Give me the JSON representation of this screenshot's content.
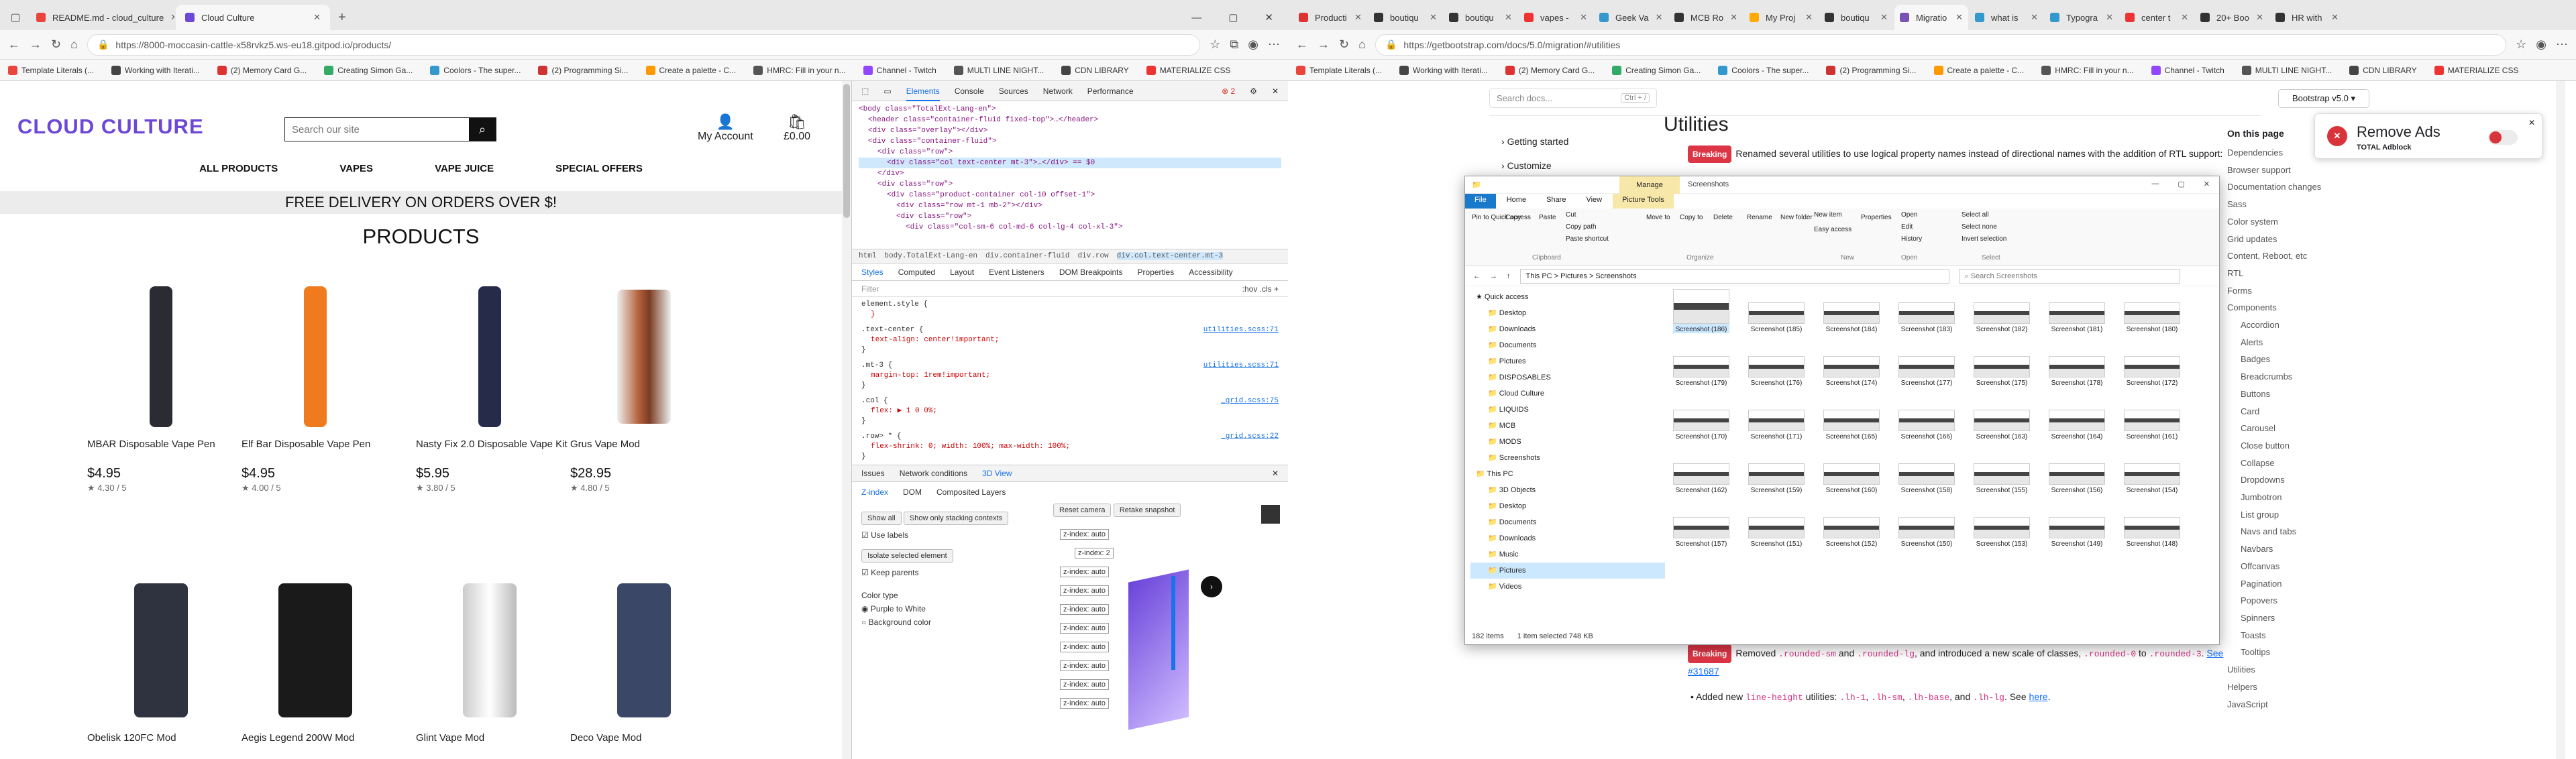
{
  "left_browser": {
    "tabs": [
      {
        "title": "README.md - cloud_culture",
        "color": "#e8453c"
      },
      {
        "title": "Cloud Culture",
        "color": "#6d48d6",
        "active": true
      }
    ],
    "url": "https://8000-moccasin-cattle-x58rvkz5.ws-eu18.gitpod.io/products/",
    "bookmarks": [
      "Template Literals (...",
      "Working with Iterati...",
      "(2) Memory Card G...",
      "Creating Simon Ga...",
      "Coolors - The super...",
      "(2) Programming Si...",
      "Create a palette - C...",
      "HMRC: Fill in your n...",
      "Channel - Twitch",
      "MULTI LINE NIGHT...",
      "CDN LIBRARY",
      "MATERIALIZE CSS"
    ]
  },
  "site": {
    "logo": "CLOUD CULTURE",
    "search_placeholder": "Search our site",
    "account_label": "My Account",
    "cart_total": "£0.00",
    "menu": [
      "ALL PRODUCTS",
      "VAPES",
      "VAPE JUICE",
      "SPECIAL OFFERS"
    ],
    "banner": "FREE DELIVERY ON ORDERS OVER $!",
    "heading": "PRODUCTS",
    "products": [
      {
        "name": "MBAR Disposable Vape Pen",
        "price": "$4.95",
        "rating": "4.30 / 5",
        "color": "#2b2b33"
      },
      {
        "name": "Elf Bar Disposable Vape Pen",
        "price": "$4.95",
        "rating": "4.00 / 5",
        "color": "#f07a1e"
      },
      {
        "name": "Nasty Fix 2.0 Disposable Vape Kit",
        "price": "$5.95",
        "rating": "3.80 / 5",
        "color": "#262b4a"
      },
      {
        "name": "Grus Vape Mod",
        "price": "$28.95",
        "rating": "4.80 / 5",
        "color": "#b4613b"
      },
      {
        "name": "Obelisk 120FC Mod",
        "color": "#2f3340"
      },
      {
        "name": "Aegis Legend 200W Mod",
        "color": "#1a1a1a"
      },
      {
        "name": "Glint Vape Mod",
        "color": "#d9d9d9"
      },
      {
        "name": "Deco Vape Mod",
        "color": "#3a4766"
      }
    ]
  },
  "devtools": {
    "tabs": [
      "Elements",
      "Console",
      "Sources",
      "Network",
      "Performance"
    ],
    "issues": "2",
    "dom_lines": [
      "<body class=\"TotalExt-Lang-en\">",
      "<header class=\"container-fluid fixed-top\">…</header>",
      "<div class=\"overlay\"></div>",
      "<div class=\"container-fluid\">",
      "<div class=\"row\">",
      "<div class=\"col text-center mt-3\">…</div> == $0",
      "</div>",
      "<div class=\"row\">",
      "<div class=\"product-container col-10 offset-1\">",
      "<div class=\"row mt-1 mb-2\"></div>",
      "<div class=\"row\">",
      "<div class=\"col-sm-6 col-md-6 col-lg-4 col-xl-3\">"
    ],
    "breadcrumbs": [
      "html",
      "body.TotalExt-Lang-en",
      "div.container-fluid",
      "div.row",
      "div.col.text-center.mt-3"
    ],
    "style_tabs": [
      "Styles",
      "Computed",
      "Layout",
      "Event Listeners",
      "DOM Breakpoints",
      "Properties",
      "Accessibility"
    ],
    "filter": "Filter",
    "css_rules": [
      {
        "selector": "element.style {",
        "body": "}",
        "src": ""
      },
      {
        "selector": ".text-center {",
        "body": "text-align: center!important;",
        "src": "utilities.scss:71"
      },
      {
        "selector": ".mt-3 {",
        "body": "margin-top: 1rem!important;",
        "src": "utilities.scss:71"
      },
      {
        "selector": ".col {",
        "body": "flex: ▶ 1 0 0%;",
        "src": "_grid.scss:75"
      },
      {
        "selector": ".row> * {",
        "body": "flex-shrink: 0; width: 100%; max-width: 100%;",
        "src": "_grid.scss:22"
      }
    ],
    "bottom_tabs": [
      "Issues",
      "Network conditions",
      "3D View"
    ],
    "three_tabs": [
      "Z-index",
      "DOM",
      "Composited Layers"
    ],
    "reset_camera": "Reset camera",
    "retake": "Retake snapshot",
    "show_all": "Show all",
    "show_stacking": "Show only stacking contexts",
    "use_labels": "Use labels",
    "isolate": "Isolate selected element",
    "keep_parents": "Keep parents",
    "color_type": "Color type",
    "purple_white": "Purple to White",
    "bg_color": "Background color",
    "zlabels": [
      "z-index: auto",
      "z-index: 2",
      "z-index: auto",
      "z-index: auto",
      "z-index: auto",
      "z-index: auto",
      "z-index: auto",
      "z-index: auto",
      "z-index: auto",
      "z-index: auto"
    ]
  },
  "right_browser": {
    "tabs": [
      "Producti",
      "boutiqu",
      "boutiqu",
      "vapes -",
      "Geek Va",
      "MCB Ro",
      "My Proj",
      "boutiqu",
      "Migratio",
      "what is",
      "Typogra",
      "center t",
      "20+ Boo",
      "HR with"
    ],
    "url": "https://getbootstrap.com/docs/5.0/migration/#utilities",
    "bookmarks": [
      "Template Literals (...",
      "Working with Iterati...",
      "(2) Memory Card G...",
      "Creating Simon Ga...",
      "Coolors - The super...",
      "(2) Programming Si...",
      "Create a palette - C...",
      "HMRC: Fill in your n...",
      "Channel - Twitch",
      "MULTI LINE NIGHT...",
      "CDN LIBRARY",
      "MATERIALIZE CSS"
    ]
  },
  "bootstrap": {
    "search_placeholder": "Search docs...",
    "search_hint": "Ctrl + /",
    "version": "Bootstrap v5.0",
    "sidebar": [
      "Getting started",
      "Customize"
    ],
    "heading": "Utilities",
    "breaking": "Breaking",
    "para1": "Renamed several utilities to use logical property names instead of directional names with the addition of RTL support:",
    "para2_a": "Removed",
    "para2_code1": ".rounded-sm",
    "para2_and": "and",
    "para2_code2": ".rounded-lg",
    "para2_b": ", and introduced a new scale of classes,",
    "para2_code3": ".rounded-0",
    "para2_to": "to",
    "para2_code4": ".rounded-3",
    "para2_see": "See #31687",
    "para3_a": "Added new",
    "para3_code": "line-height",
    "para3_b": "utilities:",
    "para3_code1": ".lh-1",
    "para3_code2": ".lh-sm",
    "para3_code3": ".lh-base",
    "para3_and": "and",
    "para3_code4": ".lh-lg",
    "para3_see": "See",
    "para3_here": "here",
    "on_page_title": "On this page",
    "on_page": [
      "Dependencies",
      "Browser support",
      "Documentation changes",
      "Sass",
      "Color system",
      "Grid updates",
      "Content, Reboot, etc",
      "RTL",
      "Forms",
      "Components",
      "Accordion",
      "Alerts",
      "Badges",
      "Breadcrumbs",
      "Buttons",
      "Card",
      "Carousel",
      "Close button",
      "Collapse",
      "Dropdowns",
      "Jumbotron",
      "List group",
      "Navs and tabs",
      "Navbars",
      "Offcanvas",
      "Pagination",
      "Popovers",
      "Spinners",
      "Toasts",
      "Tooltips",
      "Utilities",
      "Helpers",
      "JavaScript"
    ],
    "adblock_title": "Remove Ads",
    "adblock_sub": "TOTAL Adblock"
  },
  "explorer": {
    "title": "Screenshots",
    "manage": "Manage",
    "ribbon_tabs": [
      "File",
      "Home",
      "Share",
      "View",
      "Picture Tools"
    ],
    "ribbon_actions": [
      "Pin to Quick access",
      "Copy",
      "Paste",
      "Cut",
      "Copy path",
      "Paste shortcut",
      "Move to",
      "Copy to",
      "Delete",
      "Rename",
      "New folder",
      "New item",
      "Easy access",
      "Properties",
      "Open",
      "Edit",
      "History",
      "Select all",
      "Select none",
      "Invert selection"
    ],
    "groups": [
      "Clipboard",
      "Organize",
      "New",
      "Open",
      "Select"
    ],
    "path": "This PC  >  Pictures  >  Screenshots",
    "search": "Search Screenshots",
    "nav": [
      "Quick access",
      "Desktop",
      "Downloads",
      "Documents",
      "Pictures",
      "DISPOSABLES",
      "Cloud Culture",
      "LIQUIDS",
      "MCB",
      "MODS",
      "Screenshots",
      "This PC",
      "3D Objects",
      "Desktop",
      "Documents",
      "Downloads",
      "Music",
      "Pictures",
      "Videos"
    ],
    "thumbs": [
      "Screenshot (186)",
      "Screenshot (185)",
      "Screenshot (184)",
      "Screenshot (183)",
      "Screenshot (182)",
      "Screenshot (181)",
      "Screenshot (180)",
      "Screenshot (179)",
      "Screenshot (176)",
      "Screenshot (174)",
      "Screenshot (177)",
      "Screenshot (175)",
      "Screenshot (178)",
      "Screenshot (172)",
      "Screenshot (170)",
      "Screenshot (171)",
      "Screenshot (165)",
      "Screenshot (166)",
      "Screenshot (163)",
      "Screenshot (164)",
      "Screenshot (161)",
      "Screenshot (162)",
      "Screenshot (159)",
      "Screenshot (160)",
      "Screenshot (158)",
      "Screenshot (155)",
      "Screenshot (156)",
      "Screenshot (154)",
      "Screenshot (157)",
      "Screenshot (151)",
      "Screenshot (152)",
      "Screenshot (150)",
      "Screenshot (153)",
      "Screenshot (149)",
      "Screenshot (148)"
    ],
    "status_items": "182 items",
    "status_sel": "1 item selected  748 KB"
  }
}
